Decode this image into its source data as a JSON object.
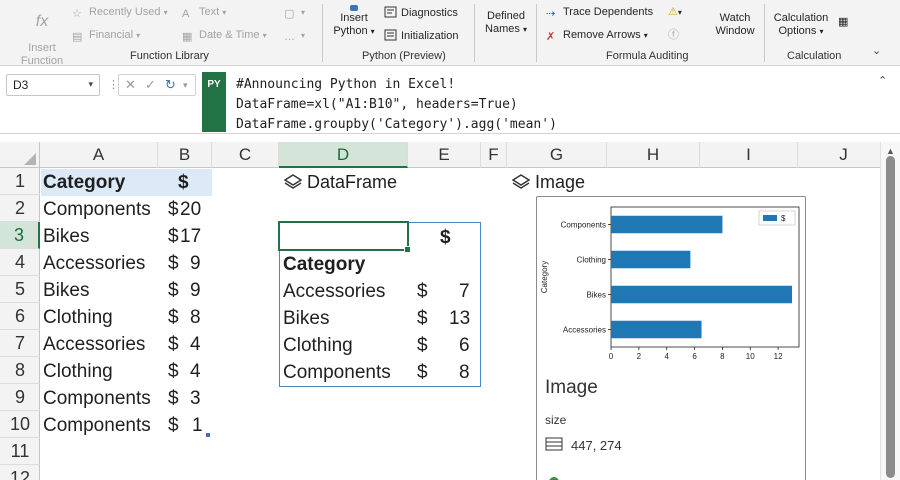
{
  "ribbon": {
    "insert_function": "Insert\nFunction",
    "recently_used": "Recently Used",
    "financial": "Financial",
    "text": "Text",
    "date_time": "Date & Time",
    "function_library_label": "Function Library",
    "insert_python": "Insert\nPython",
    "diagnostics": "Diagnostics",
    "initialization": "Initialization",
    "python_preview_label": "Python (Preview)",
    "defined_names": "Defined\nNames",
    "trace_dependents": "Trace Dependents",
    "remove_arrows": "Remove Arrows",
    "watch_window": "Watch\nWindow",
    "formula_auditing_label": "Formula Auditing",
    "calculation_options": "Calculation\nOptions",
    "calculation_label": "Calculation"
  },
  "formula_bar": {
    "name_box": "D3",
    "badge": "PY",
    "code_lines": [
      "#Announcing Python in Excel!",
      "DataFrame=xl(\"A1:B10\", headers=True)",
      "DataFrame.groupby('Category').agg('mean')"
    ]
  },
  "columns": [
    "A",
    "B",
    "C",
    "D",
    "E",
    "F",
    "G",
    "H",
    "I",
    "J"
  ],
  "rows": [
    "1",
    "2",
    "3",
    "4",
    "5",
    "6",
    "7",
    "8",
    "9",
    "10",
    "11",
    "12"
  ],
  "sheet": {
    "header_category": "Category",
    "header_value": "$",
    "data": [
      {
        "category": "Components",
        "currency": "$",
        "value": "20"
      },
      {
        "category": "Bikes",
        "currency": "$",
        "value": "17"
      },
      {
        "category": "Accessories",
        "currency": "$",
        "value": "9"
      },
      {
        "category": "Bikes",
        "currency": "$",
        "value": "9"
      },
      {
        "category": "Clothing",
        "currency": "$",
        "value": "8"
      },
      {
        "category": "Accessories",
        "currency": "$",
        "value": "4"
      },
      {
        "category": "Clothing",
        "currency": "$",
        "value": "4"
      },
      {
        "category": "Components",
        "currency": "$",
        "value": "3"
      },
      {
        "category": "Components",
        "currency": "$",
        "value": "1"
      }
    ]
  },
  "dataframe": {
    "title": "DataFrame",
    "value_header": "$",
    "index_header": "Category",
    "rows": [
      {
        "category": "Accessories",
        "currency": "$",
        "value": "7"
      },
      {
        "category": "Bikes",
        "currency": "$",
        "value": "13"
      },
      {
        "category": "Clothing",
        "currency": "$",
        "value": "6"
      },
      {
        "category": "Components",
        "currency": "$",
        "value": "8"
      }
    ]
  },
  "image_card": {
    "title": "Image",
    "heading": "Image",
    "size_label": "size",
    "size_value": "447, 274"
  },
  "chart_data": {
    "type": "bar",
    "orientation": "horizontal",
    "categories": [
      "Accessories",
      "Bikes",
      "Clothing",
      "Components"
    ],
    "series": [
      {
        "name": "$",
        "values": [
          6.5,
          13,
          5.7,
          8
        ]
      }
    ],
    "xlabel": "",
    "ylabel": "Category",
    "xlim": [
      0,
      13.5
    ],
    "x_ticks": [
      0,
      2,
      4,
      6,
      8,
      10,
      12
    ],
    "legend": "top-right",
    "grid": false,
    "colors": {
      "bar": "#1f77b4"
    }
  },
  "colors": {
    "excel_green": "#217346",
    "header_fill": "#dce9f7",
    "spill_border": "#4a86c8"
  }
}
